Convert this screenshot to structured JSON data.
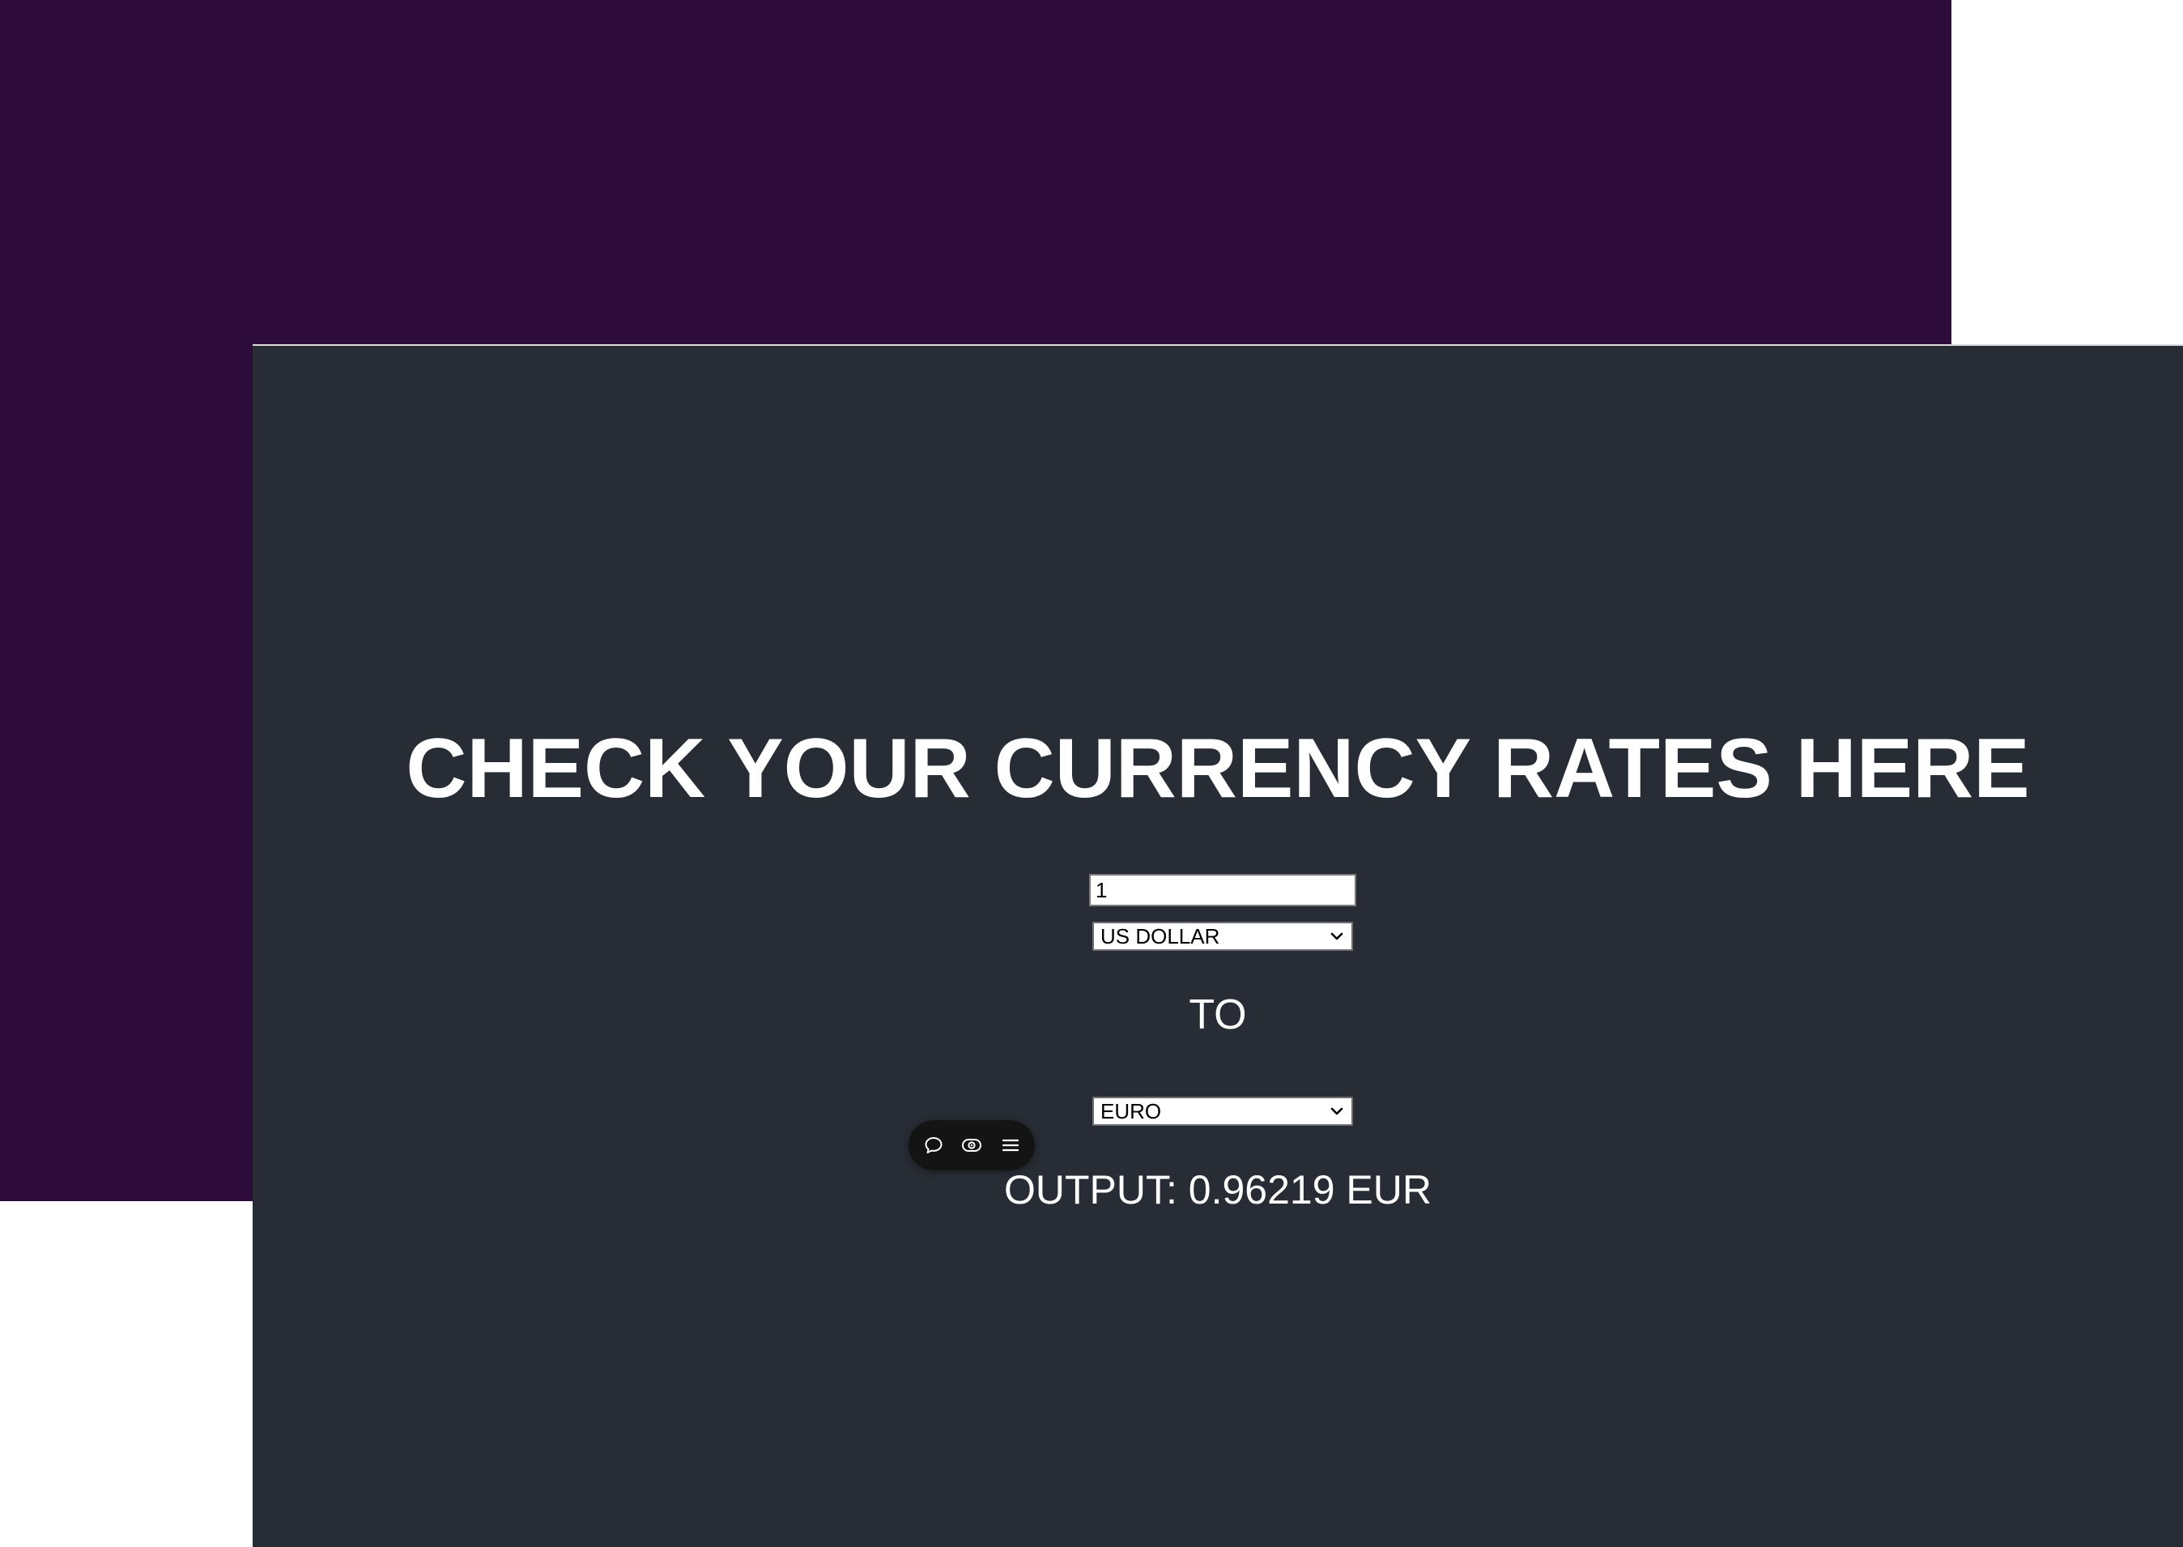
{
  "page": {
    "title": "CHECK YOUR CURRENCY RATES HERE",
    "to_label": "TO",
    "output_label": "OUTPUT: 0.96219 EUR"
  },
  "form": {
    "amount_value": "1",
    "from_currency": "US DOLLAR",
    "to_currency": "EURO"
  },
  "toolbar": {
    "icons": [
      "comment-icon",
      "eye-icon",
      "menu-icon"
    ]
  },
  "colors": {
    "purple_background": "#2d0b3b",
    "panel_background": "#282c34",
    "text": "#ffffff",
    "toolbar_background": "#141414"
  }
}
